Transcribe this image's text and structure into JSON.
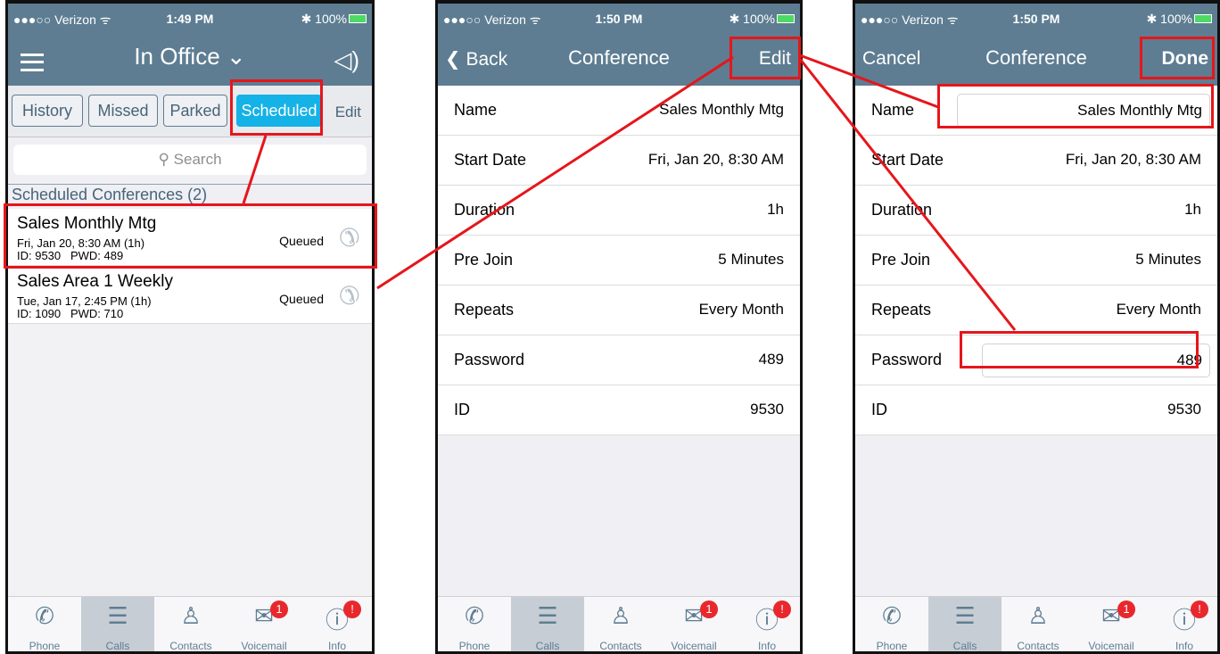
{
  "status": {
    "carrier": "●●●○○ Verizon ᯤ",
    "battery": "✱ 100%",
    "time_1": "1:49 PM",
    "time_2": "1:50 PM",
    "time_3": "1:50 PM"
  },
  "phone1": {
    "title": "In Office ⌄",
    "tabs": [
      "History",
      "Missed",
      "Parked",
      "Scheduled"
    ],
    "edit_label": "Edit",
    "search_placeholder": "Search",
    "section_header": "Scheduled Conferences (2)",
    "conferences": [
      {
        "name": "Sales Monthly Mtg",
        "schedule": "Fri, Jan 20, 8:30 AM (1h)",
        "credentials": "ID: 9530   PWD: 489",
        "status": "Queued"
      },
      {
        "name": "Sales Area 1 Weekly",
        "schedule": "Tue, Jan 17, 2:45 PM (1h)",
        "credentials": "ID: 1090   PWD: 710",
        "status": "Queued"
      }
    ]
  },
  "phone2": {
    "back_label": "Back",
    "title": "Conference",
    "edit_label": "Edit",
    "rows": [
      {
        "label": "Name",
        "value": "Sales Monthly Mtg"
      },
      {
        "label": "Start Date",
        "value": "Fri, Jan 20, 8:30 AM"
      },
      {
        "label": "Duration",
        "value": "1h"
      },
      {
        "label": "Pre Join",
        "value": "5 Minutes"
      },
      {
        "label": "Repeats",
        "value": "Every Month"
      },
      {
        "label": "Password",
        "value": "489"
      },
      {
        "label": "ID",
        "value": "9530"
      }
    ]
  },
  "phone3": {
    "cancel_label": "Cancel",
    "title": "Conference",
    "done_label": "Done",
    "rows": [
      {
        "label": "Name",
        "value": "Sales Monthly Mtg"
      },
      {
        "label": "Start Date",
        "value": "Fri, Jan 20, 8:30 AM"
      },
      {
        "label": "Duration",
        "value": "1h"
      },
      {
        "label": "Pre Join",
        "value": "5 Minutes"
      },
      {
        "label": "Repeats",
        "value": "Every Month"
      },
      {
        "label": "Password",
        "value": "489"
      },
      {
        "label": "ID",
        "value": "9530"
      }
    ]
  },
  "tabbar": {
    "items": [
      {
        "label": "Phone",
        "icon": "phone-icon"
      },
      {
        "label": "Calls",
        "icon": "list-icon"
      },
      {
        "label": "Contacts",
        "icon": "person-icon"
      },
      {
        "label": "Voicemail",
        "icon": "envelope-icon",
        "badge": "1"
      },
      {
        "label": "Info",
        "icon": "info-icon",
        "badge": "!"
      }
    ]
  },
  "colors": {
    "header": "#5e7d92",
    "accent": "#14b2e6",
    "annotation": "#e5161b",
    "badge": "#e8282c"
  }
}
